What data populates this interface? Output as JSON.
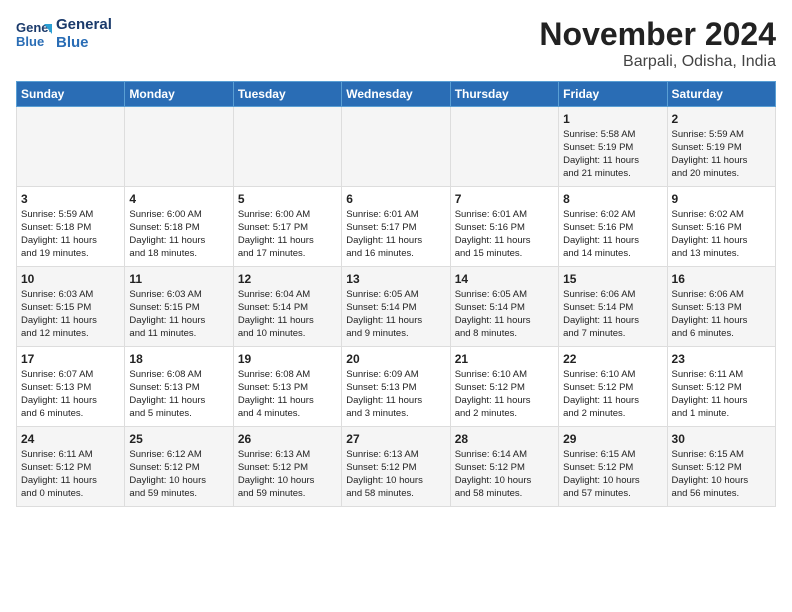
{
  "logo": {
    "line1": "General",
    "line2": "Blue"
  },
  "title": "November 2024",
  "location": "Barpali, Odisha, India",
  "headers": [
    "Sunday",
    "Monday",
    "Tuesday",
    "Wednesday",
    "Thursday",
    "Friday",
    "Saturday"
  ],
  "weeks": [
    [
      {
        "day": "",
        "data": ""
      },
      {
        "day": "",
        "data": ""
      },
      {
        "day": "",
        "data": ""
      },
      {
        "day": "",
        "data": ""
      },
      {
        "day": "",
        "data": ""
      },
      {
        "day": "1",
        "data": "Sunrise: 5:58 AM\nSunset: 5:19 PM\nDaylight: 11 hours\nand 21 minutes."
      },
      {
        "day": "2",
        "data": "Sunrise: 5:59 AM\nSunset: 5:19 PM\nDaylight: 11 hours\nand 20 minutes."
      }
    ],
    [
      {
        "day": "3",
        "data": "Sunrise: 5:59 AM\nSunset: 5:18 PM\nDaylight: 11 hours\nand 19 minutes."
      },
      {
        "day": "4",
        "data": "Sunrise: 6:00 AM\nSunset: 5:18 PM\nDaylight: 11 hours\nand 18 minutes."
      },
      {
        "day": "5",
        "data": "Sunrise: 6:00 AM\nSunset: 5:17 PM\nDaylight: 11 hours\nand 17 minutes."
      },
      {
        "day": "6",
        "data": "Sunrise: 6:01 AM\nSunset: 5:17 PM\nDaylight: 11 hours\nand 16 minutes."
      },
      {
        "day": "7",
        "data": "Sunrise: 6:01 AM\nSunset: 5:16 PM\nDaylight: 11 hours\nand 15 minutes."
      },
      {
        "day": "8",
        "data": "Sunrise: 6:02 AM\nSunset: 5:16 PM\nDaylight: 11 hours\nand 14 minutes."
      },
      {
        "day": "9",
        "data": "Sunrise: 6:02 AM\nSunset: 5:16 PM\nDaylight: 11 hours\nand 13 minutes."
      }
    ],
    [
      {
        "day": "10",
        "data": "Sunrise: 6:03 AM\nSunset: 5:15 PM\nDaylight: 11 hours\nand 12 minutes."
      },
      {
        "day": "11",
        "data": "Sunrise: 6:03 AM\nSunset: 5:15 PM\nDaylight: 11 hours\nand 11 minutes."
      },
      {
        "day": "12",
        "data": "Sunrise: 6:04 AM\nSunset: 5:14 PM\nDaylight: 11 hours\nand 10 minutes."
      },
      {
        "day": "13",
        "data": "Sunrise: 6:05 AM\nSunset: 5:14 PM\nDaylight: 11 hours\nand 9 minutes."
      },
      {
        "day": "14",
        "data": "Sunrise: 6:05 AM\nSunset: 5:14 PM\nDaylight: 11 hours\nand 8 minutes."
      },
      {
        "day": "15",
        "data": "Sunrise: 6:06 AM\nSunset: 5:14 PM\nDaylight: 11 hours\nand 7 minutes."
      },
      {
        "day": "16",
        "data": "Sunrise: 6:06 AM\nSunset: 5:13 PM\nDaylight: 11 hours\nand 6 minutes."
      }
    ],
    [
      {
        "day": "17",
        "data": "Sunrise: 6:07 AM\nSunset: 5:13 PM\nDaylight: 11 hours\nand 6 minutes."
      },
      {
        "day": "18",
        "data": "Sunrise: 6:08 AM\nSunset: 5:13 PM\nDaylight: 11 hours\nand 5 minutes."
      },
      {
        "day": "19",
        "data": "Sunrise: 6:08 AM\nSunset: 5:13 PM\nDaylight: 11 hours\nand 4 minutes."
      },
      {
        "day": "20",
        "data": "Sunrise: 6:09 AM\nSunset: 5:13 PM\nDaylight: 11 hours\nand 3 minutes."
      },
      {
        "day": "21",
        "data": "Sunrise: 6:10 AM\nSunset: 5:12 PM\nDaylight: 11 hours\nand 2 minutes."
      },
      {
        "day": "22",
        "data": "Sunrise: 6:10 AM\nSunset: 5:12 PM\nDaylight: 11 hours\nand 2 minutes."
      },
      {
        "day": "23",
        "data": "Sunrise: 6:11 AM\nSunset: 5:12 PM\nDaylight: 11 hours\nand 1 minute."
      }
    ],
    [
      {
        "day": "24",
        "data": "Sunrise: 6:11 AM\nSunset: 5:12 PM\nDaylight: 11 hours\nand 0 minutes."
      },
      {
        "day": "25",
        "data": "Sunrise: 6:12 AM\nSunset: 5:12 PM\nDaylight: 10 hours\nand 59 minutes."
      },
      {
        "day": "26",
        "data": "Sunrise: 6:13 AM\nSunset: 5:12 PM\nDaylight: 10 hours\nand 59 minutes."
      },
      {
        "day": "27",
        "data": "Sunrise: 6:13 AM\nSunset: 5:12 PM\nDaylight: 10 hours\nand 58 minutes."
      },
      {
        "day": "28",
        "data": "Sunrise: 6:14 AM\nSunset: 5:12 PM\nDaylight: 10 hours\nand 58 minutes."
      },
      {
        "day": "29",
        "data": "Sunrise: 6:15 AM\nSunset: 5:12 PM\nDaylight: 10 hours\nand 57 minutes."
      },
      {
        "day": "30",
        "data": "Sunrise: 6:15 AM\nSunset: 5:12 PM\nDaylight: 10 hours\nand 56 minutes."
      }
    ]
  ]
}
